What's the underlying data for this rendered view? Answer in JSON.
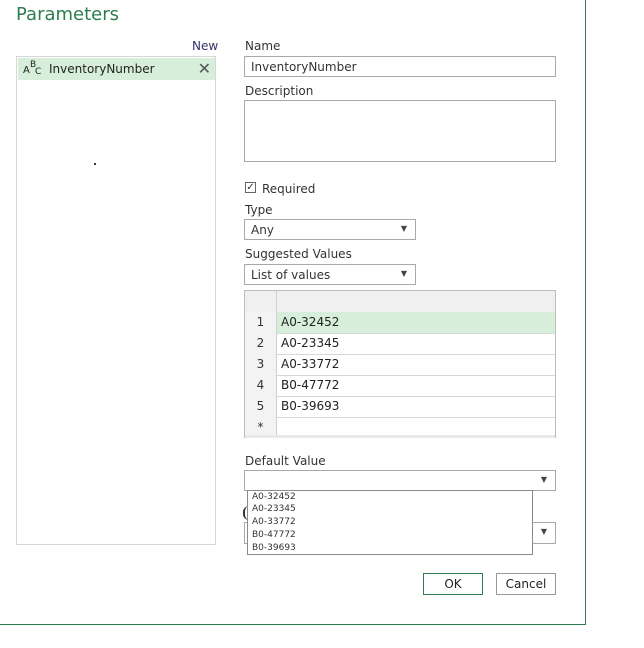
{
  "dialog": {
    "title": "Parameters"
  },
  "left": {
    "new_label": "New",
    "items": [
      {
        "name": "InventoryNumber",
        "type_icon": "abc-icon"
      }
    ]
  },
  "form": {
    "name_label": "Name",
    "name_value": "InventoryNumber",
    "description_label": "Description",
    "description_value": "",
    "required_label": "Required",
    "required_checked": true,
    "type_label": "Type",
    "type_value": "Any",
    "suggested_label": "Suggested Values",
    "suggested_value": "List of values",
    "values": [
      {
        "n": "1",
        "v": "A0-32452"
      },
      {
        "n": "2",
        "v": "A0-23345"
      },
      {
        "n": "3",
        "v": "A0-33772"
      },
      {
        "n": "4",
        "v": "B0-47772"
      },
      {
        "n": "5",
        "v": "B0-39693"
      },
      {
        "n": "*",
        "v": ""
      }
    ],
    "default_label": "Default Value",
    "default_value": "",
    "dropdown_options": [
      "A0-32452",
      "A0-23345",
      "A0-33772",
      "B0-47772",
      "B0-39693"
    ]
  },
  "buttons": {
    "ok": "OK",
    "cancel": "Cancel"
  },
  "colors": {
    "accent": "#2e7d4f",
    "selection": "#d7eedb"
  }
}
